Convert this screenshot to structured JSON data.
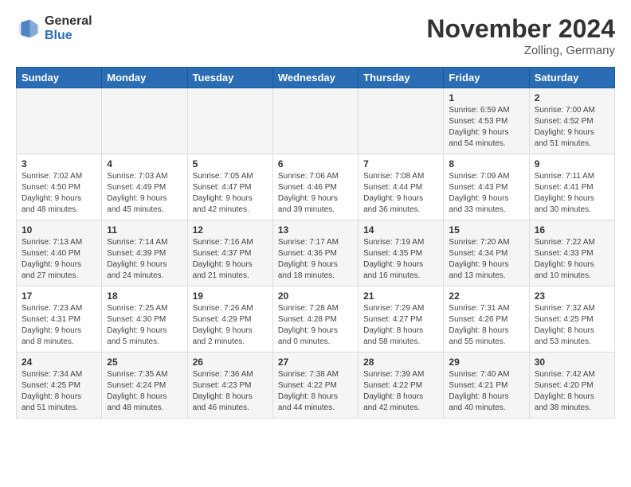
{
  "header": {
    "logo_general": "General",
    "logo_blue": "Blue",
    "month_title": "November 2024",
    "location": "Zolling, Germany"
  },
  "days_of_week": [
    "Sunday",
    "Monday",
    "Tuesday",
    "Wednesday",
    "Thursday",
    "Friday",
    "Saturday"
  ],
  "weeks": [
    [
      {
        "day": "",
        "info": ""
      },
      {
        "day": "",
        "info": ""
      },
      {
        "day": "",
        "info": ""
      },
      {
        "day": "",
        "info": ""
      },
      {
        "day": "",
        "info": ""
      },
      {
        "day": "1",
        "info": "Sunrise: 6:59 AM\nSunset: 4:53 PM\nDaylight: 9 hours\nand 54 minutes."
      },
      {
        "day": "2",
        "info": "Sunrise: 7:00 AM\nSunset: 4:52 PM\nDaylight: 9 hours\nand 51 minutes."
      }
    ],
    [
      {
        "day": "3",
        "info": "Sunrise: 7:02 AM\nSunset: 4:50 PM\nDaylight: 9 hours\nand 48 minutes."
      },
      {
        "day": "4",
        "info": "Sunrise: 7:03 AM\nSunset: 4:49 PM\nDaylight: 9 hours\nand 45 minutes."
      },
      {
        "day": "5",
        "info": "Sunrise: 7:05 AM\nSunset: 4:47 PM\nDaylight: 9 hours\nand 42 minutes."
      },
      {
        "day": "6",
        "info": "Sunrise: 7:06 AM\nSunset: 4:46 PM\nDaylight: 9 hours\nand 39 minutes."
      },
      {
        "day": "7",
        "info": "Sunrise: 7:08 AM\nSunset: 4:44 PM\nDaylight: 9 hours\nand 36 minutes."
      },
      {
        "day": "8",
        "info": "Sunrise: 7:09 AM\nSunset: 4:43 PM\nDaylight: 9 hours\nand 33 minutes."
      },
      {
        "day": "9",
        "info": "Sunrise: 7:11 AM\nSunset: 4:41 PM\nDaylight: 9 hours\nand 30 minutes."
      }
    ],
    [
      {
        "day": "10",
        "info": "Sunrise: 7:13 AM\nSunset: 4:40 PM\nDaylight: 9 hours\nand 27 minutes."
      },
      {
        "day": "11",
        "info": "Sunrise: 7:14 AM\nSunset: 4:39 PM\nDaylight: 9 hours\nand 24 minutes."
      },
      {
        "day": "12",
        "info": "Sunrise: 7:16 AM\nSunset: 4:37 PM\nDaylight: 9 hours\nand 21 minutes."
      },
      {
        "day": "13",
        "info": "Sunrise: 7:17 AM\nSunset: 4:36 PM\nDaylight: 9 hours\nand 18 minutes."
      },
      {
        "day": "14",
        "info": "Sunrise: 7:19 AM\nSunset: 4:35 PM\nDaylight: 9 hours\nand 16 minutes."
      },
      {
        "day": "15",
        "info": "Sunrise: 7:20 AM\nSunset: 4:34 PM\nDaylight: 9 hours\nand 13 minutes."
      },
      {
        "day": "16",
        "info": "Sunrise: 7:22 AM\nSunset: 4:33 PM\nDaylight: 9 hours\nand 10 minutes."
      }
    ],
    [
      {
        "day": "17",
        "info": "Sunrise: 7:23 AM\nSunset: 4:31 PM\nDaylight: 9 hours\nand 8 minutes."
      },
      {
        "day": "18",
        "info": "Sunrise: 7:25 AM\nSunset: 4:30 PM\nDaylight: 9 hours\nand 5 minutes."
      },
      {
        "day": "19",
        "info": "Sunrise: 7:26 AM\nSunset: 4:29 PM\nDaylight: 9 hours\nand 2 minutes."
      },
      {
        "day": "20",
        "info": "Sunrise: 7:28 AM\nSunset: 4:28 PM\nDaylight: 9 hours\nand 0 minutes."
      },
      {
        "day": "21",
        "info": "Sunrise: 7:29 AM\nSunset: 4:27 PM\nDaylight: 8 hours\nand 58 minutes."
      },
      {
        "day": "22",
        "info": "Sunrise: 7:31 AM\nSunset: 4:26 PM\nDaylight: 8 hours\nand 55 minutes."
      },
      {
        "day": "23",
        "info": "Sunrise: 7:32 AM\nSunset: 4:25 PM\nDaylight: 8 hours\nand 53 minutes."
      }
    ],
    [
      {
        "day": "24",
        "info": "Sunrise: 7:34 AM\nSunset: 4:25 PM\nDaylight: 8 hours\nand 51 minutes."
      },
      {
        "day": "25",
        "info": "Sunrise: 7:35 AM\nSunset: 4:24 PM\nDaylight: 8 hours\nand 48 minutes."
      },
      {
        "day": "26",
        "info": "Sunrise: 7:36 AM\nSunset: 4:23 PM\nDaylight: 8 hours\nand 46 minutes."
      },
      {
        "day": "27",
        "info": "Sunrise: 7:38 AM\nSunset: 4:22 PM\nDaylight: 8 hours\nand 44 minutes."
      },
      {
        "day": "28",
        "info": "Sunrise: 7:39 AM\nSunset: 4:22 PM\nDaylight: 8 hours\nand 42 minutes."
      },
      {
        "day": "29",
        "info": "Sunrise: 7:40 AM\nSunset: 4:21 PM\nDaylight: 8 hours\nand 40 minutes."
      },
      {
        "day": "30",
        "info": "Sunrise: 7:42 AM\nSunset: 4:20 PM\nDaylight: 8 hours\nand 38 minutes."
      }
    ]
  ]
}
